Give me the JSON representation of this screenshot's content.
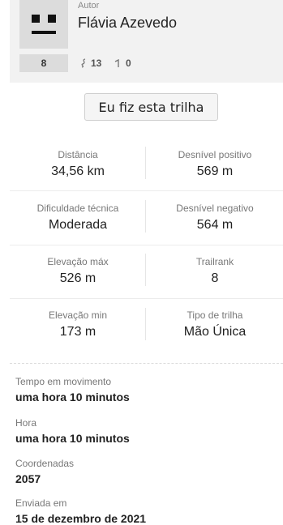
{
  "author": {
    "label": "Autor",
    "name": "Flávia Azevedo",
    "rank": "8",
    "trails_count": "13",
    "other_count": "0"
  },
  "actions": {
    "did_trail_label": "Eu fiz esta trilha"
  },
  "stats": [
    {
      "label": "Distância",
      "value": "34,56 km"
    },
    {
      "label": "Desnível positivo",
      "value": "569 m"
    },
    {
      "label": "Dificuldade técnica",
      "value": "Moderada"
    },
    {
      "label": "Desnível negativo",
      "value": "564 m"
    },
    {
      "label": "Elevação máx",
      "value": "526 m"
    },
    {
      "label": "Trailrank",
      "value": "8"
    },
    {
      "label": "Elevação min",
      "value": "173 m"
    },
    {
      "label": "Tipo de trilha",
      "value": "Mão Única"
    }
  ],
  "details": [
    {
      "label": "Tempo em movimento",
      "value": "uma hora 10 minutos"
    },
    {
      "label": "Hora",
      "value": "uma hora 10 minutos"
    },
    {
      "label": "Coordenadas",
      "value": "2057"
    },
    {
      "label": "Enviada em",
      "value": "15 de dezembro de 2021"
    }
  ]
}
